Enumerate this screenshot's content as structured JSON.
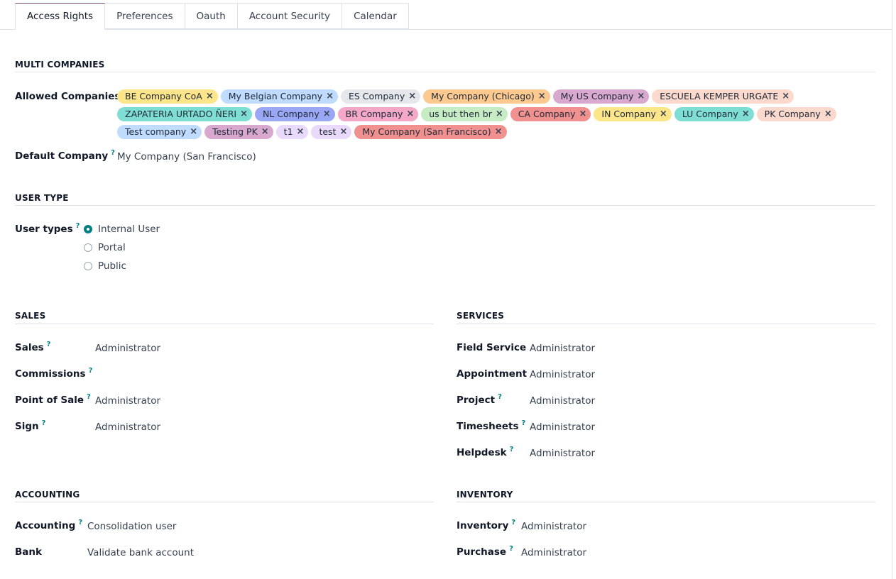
{
  "tabs": [
    {
      "label": "Access Rights",
      "active": true
    },
    {
      "label": "Preferences"
    },
    {
      "label": "Oauth"
    },
    {
      "label": "Account Security"
    },
    {
      "label": "Calendar"
    }
  ],
  "multi_companies": {
    "title": "MULTI COMPANIES",
    "allowed_label": "Allowed Companies",
    "default_label": "Default Company",
    "default_help": "?",
    "default_value": "My Company (San Francisco)",
    "remove_icon": "×",
    "companies": [
      {
        "name": "BE Company CoA",
        "color": "#fde68a"
      },
      {
        "name": "My Belgian Company",
        "color": "#bfdbfe"
      },
      {
        "name": "ES Company",
        "color": "#e5e7eb"
      },
      {
        "name": "My Company (Chicago)",
        "color": "#fcc98f"
      },
      {
        "name": "My US Company",
        "color": "#d8a8cf"
      },
      {
        "name": "ESCUELA KEMPER URGATE",
        "color": "#fbd9cc"
      },
      {
        "name": "ZAPATERIA URTADO ÑERI",
        "color": "#7fded4"
      },
      {
        "name": "NL Company",
        "color": "#9aa7f5"
      },
      {
        "name": "BR Company",
        "color": "#f3a8c8"
      },
      {
        "name": "us but then br",
        "color": "#c7ecc4"
      },
      {
        "name": "CA Company",
        "color": "#f1918f"
      },
      {
        "name": "IN Company",
        "color": "#fde68a"
      },
      {
        "name": "LU Company",
        "color": "#7fded4"
      },
      {
        "name": "PK Company",
        "color": "#fbd9cc"
      },
      {
        "name": "Test company",
        "color": "#bfdbfe"
      },
      {
        "name": "Testing PK",
        "color": "#d8a8cf"
      },
      {
        "name": "t1",
        "color": "#e9d9fb"
      },
      {
        "name": "test",
        "color": "#e9d9fb"
      },
      {
        "name": "My Company (San Francisco)",
        "color": "#f1918f"
      }
    ]
  },
  "user_type": {
    "title": "USER TYPE",
    "label": "User types",
    "help": "?",
    "options": [
      {
        "label": "Internal User",
        "checked": true
      },
      {
        "label": "Portal"
      },
      {
        "label": "Public"
      }
    ]
  },
  "sales": {
    "title": "SALES",
    "rows": [
      {
        "label": "Sales",
        "help": "?",
        "value": "Administrator"
      },
      {
        "label": "Commissions",
        "help": "?",
        "value": ""
      },
      {
        "label": "Point of Sale",
        "help": "?",
        "value": "Administrator"
      },
      {
        "label": "Sign",
        "help": "?",
        "value": "Administrator"
      }
    ]
  },
  "services": {
    "title": "SERVICES",
    "rows": [
      {
        "label": "Field Service",
        "help": "",
        "value": "Administrator"
      },
      {
        "label": "Appointment",
        "help": "",
        "value": "Administrator"
      },
      {
        "label": "Project",
        "help": "?",
        "value": "Administrator"
      },
      {
        "label": "Timesheets",
        "help": "?",
        "value": "Administrator"
      },
      {
        "label": "Helpdesk",
        "help": "?",
        "value": "Administrator"
      }
    ]
  },
  "accounting": {
    "title": "ACCOUNTING",
    "rows": [
      {
        "label": "Accounting",
        "help": "?",
        "value": "Consolidation user"
      },
      {
        "label": "Bank",
        "help": "",
        "value": "Validate bank account"
      }
    ]
  },
  "inventory": {
    "title": "INVENTORY",
    "rows": [
      {
        "label": "Inventory",
        "help": "?",
        "value": "Administrator"
      },
      {
        "label": "Purchase",
        "help": "?",
        "value": "Administrator"
      }
    ]
  }
}
